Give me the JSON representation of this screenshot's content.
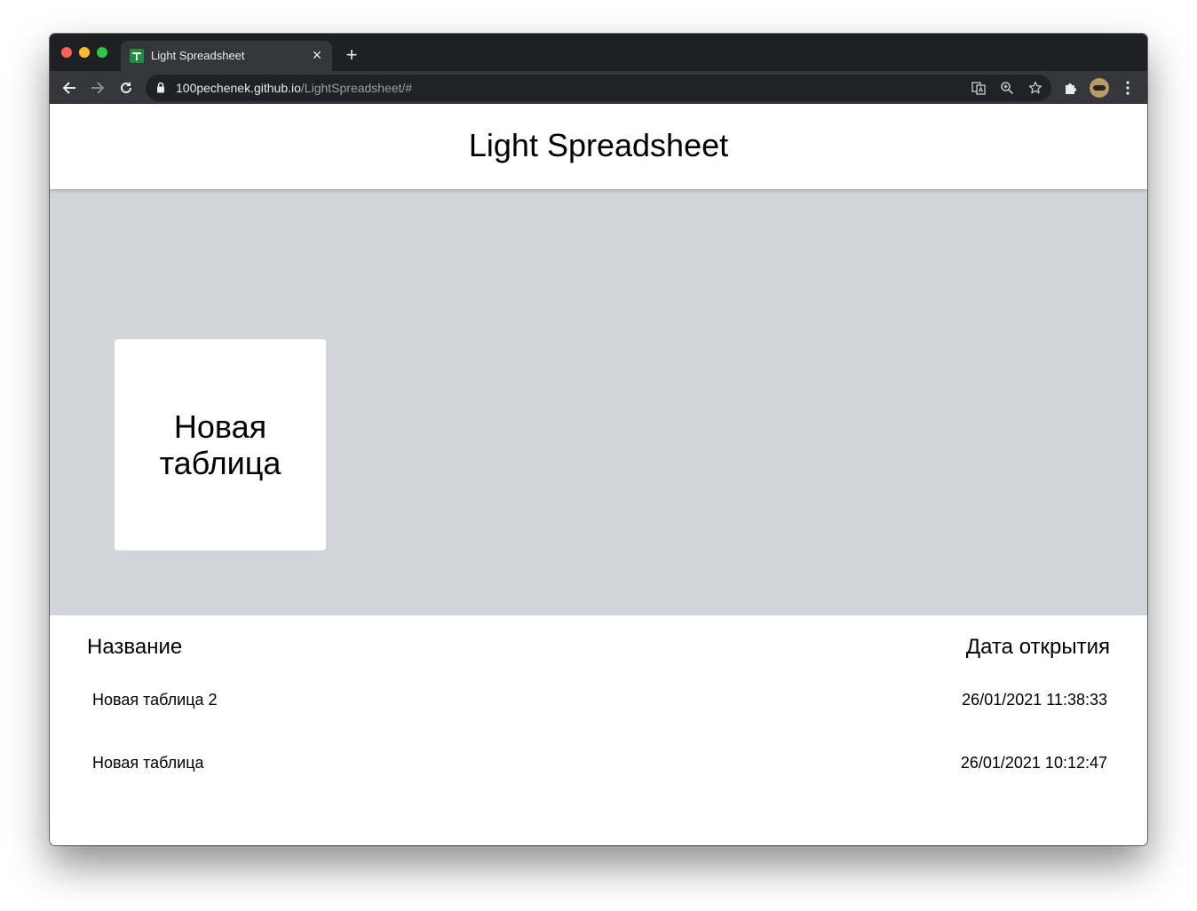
{
  "browser": {
    "tab": {
      "title": "Light Spreadsheet",
      "close": "×"
    },
    "new_tab": "+",
    "url": {
      "host": "100pechenek.github.io",
      "path": "/LightSpreadsheet/#"
    }
  },
  "app": {
    "title": "Light Spreadsheet",
    "new_table_card": "Новая таблица"
  },
  "table": {
    "headers": {
      "name": "Название",
      "date": "Дата открытия"
    },
    "rows": [
      {
        "name": "Новая таблица 2",
        "date": "26/01/2021 11:38:33"
      },
      {
        "name": "Новая таблица",
        "date": "26/01/2021 10:12:47"
      }
    ]
  }
}
